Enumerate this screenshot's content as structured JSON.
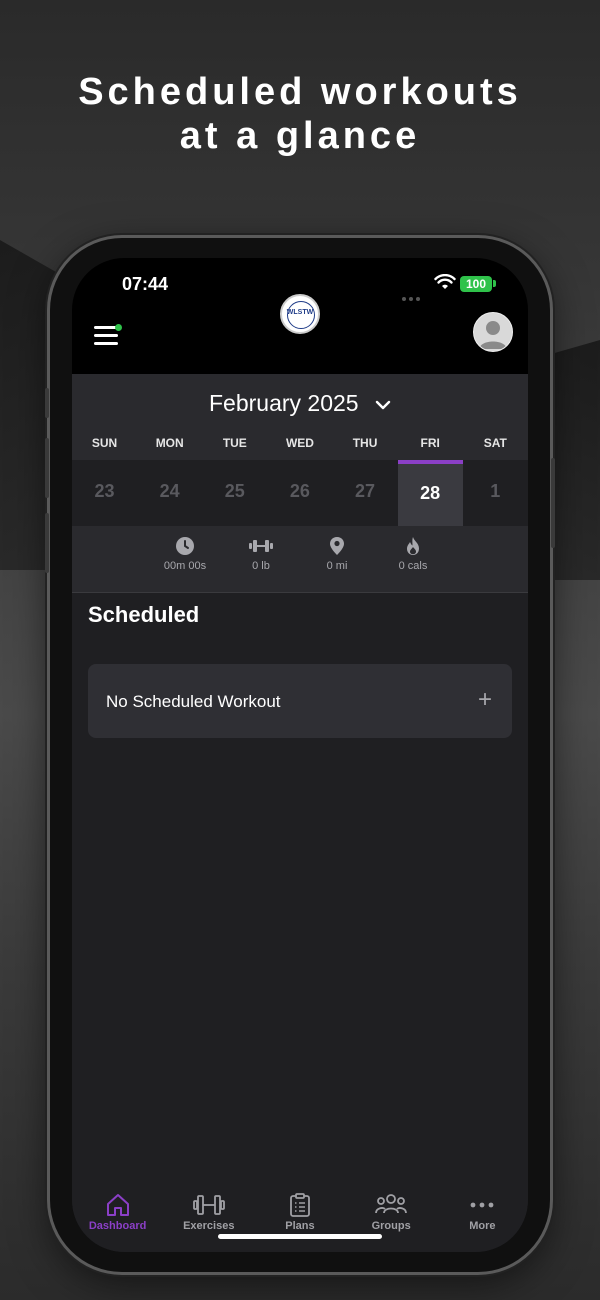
{
  "headline": {
    "line1": "Scheduled workouts",
    "line2": "at a glance"
  },
  "status_bar": {
    "time": "07:44",
    "battery": "100",
    "battery_color": "#2fc24a"
  },
  "top_bar": {
    "logo_text": "WLSTW",
    "menu_icon": "hamburger-icon",
    "notification_dot_color": "#2fc24a",
    "avatar_icon": "avatar-placeholder"
  },
  "calendar": {
    "month_label": "February 2025",
    "weekdays": [
      "SUN",
      "MON",
      "TUE",
      "WED",
      "THU",
      "FRI",
      "SAT"
    ],
    "dates": [
      "23",
      "24",
      "25",
      "26",
      "27",
      "28",
      "1"
    ],
    "selected_index": 5,
    "accent_color": "#8b3fc7"
  },
  "stats": {
    "duration": "00m 00s",
    "weight": "0 lb",
    "distance": "0 mi",
    "calories": "0 cals"
  },
  "scheduled": {
    "title": "Scheduled",
    "empty_label": "No Scheduled Workout",
    "add_symbol": "+"
  },
  "tabs": [
    {
      "label": "Dashboard",
      "icon": "home-icon",
      "active": true
    },
    {
      "label": "Exercises",
      "icon": "dumbbell-icon",
      "active": false
    },
    {
      "label": "Plans",
      "icon": "clipboard-icon",
      "active": false
    },
    {
      "label": "Groups",
      "icon": "group-icon",
      "active": false
    },
    {
      "label": "More",
      "icon": "more-icon",
      "active": false
    }
  ]
}
